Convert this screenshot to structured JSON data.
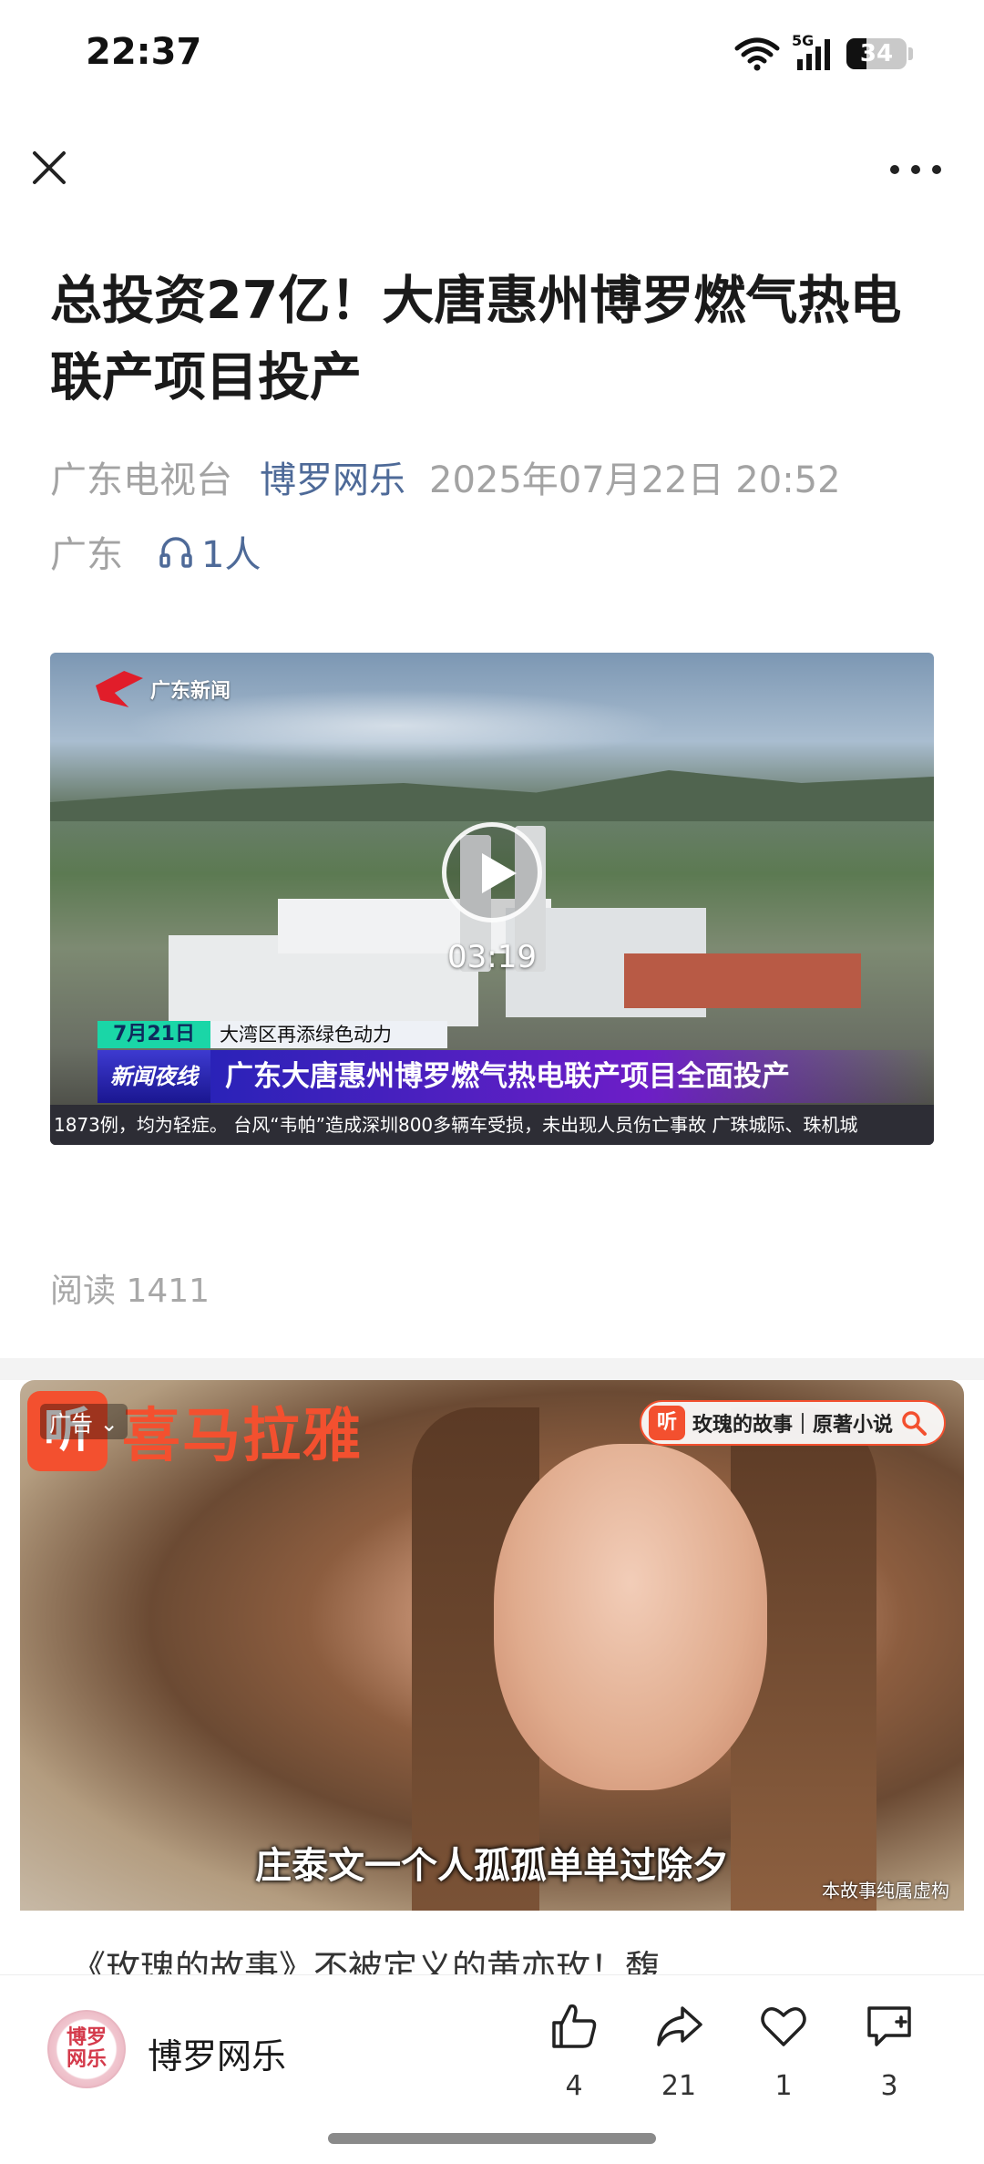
{
  "status_bar": {
    "time": "22:37",
    "network": "5G",
    "battery": "34"
  },
  "article": {
    "title": "总投资27亿！大唐惠州博罗燃气热电联产项目投产",
    "source": "广东电视台",
    "author": "博罗网乐",
    "datetime": "2025年07月22日 20:52",
    "region": "广东",
    "listeners": "1人",
    "read_count": "阅读 1411"
  },
  "video": {
    "duration": "03:19",
    "channel_logo": "广东新闻",
    "date_tag": "7月21日",
    "subtitle_tag": "大湾区再添绿色动力",
    "program_tag": "新闻夜线",
    "headline": "广东大唐惠州博罗燃气热电联产项目全面投产",
    "ticker": "1873例，均为轻症。  台风“韦帕”造成深圳800多辆车受损，未出现人员伤亡事故    广珠城际、珠机城"
  },
  "ad": {
    "label": "广告",
    "brand": "喜马拉雅",
    "brand_mark": "听",
    "search_text": "玫瑰的故事｜原著小说",
    "subtitle": "庄泰文一个人孤孤单单过除夕",
    "disclaimer": "本故事纯属虚构",
    "caption": "《玫瑰的故事》不被定义的黄亦玫！馥"
  },
  "bottom_bar": {
    "account_name": "博罗网乐",
    "avatar_text_1": "博罗",
    "avatar_text_2": "网乐",
    "like_count": "4",
    "share_count": "21",
    "favorite_count": "1",
    "comment_count": "3"
  }
}
